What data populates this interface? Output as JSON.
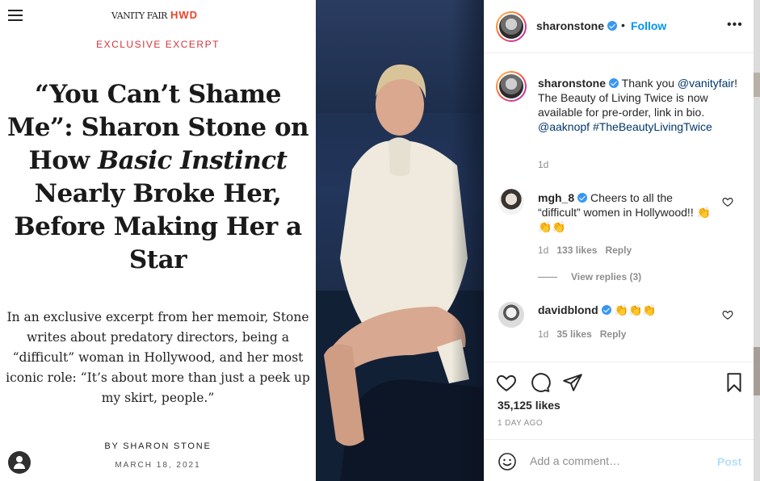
{
  "article": {
    "brand": "VANITY FAIR",
    "brand_sub": "HWD",
    "kicker": "EXCLUSIVE EXCERPT",
    "headline_part1": "“You Can’t Shame Me”: Sharon Stone on How ",
    "headline_italic": "Basic Instinct",
    "headline_part2": " Nearly Broke Her, Before Making Her a Star",
    "dek": "In an exclusive excerpt from her memoir, Stone writes about predatory directors, being a “difficult” woman in Hollywood, and her most iconic role: “It’s about more than just a peek up my skirt, people.”",
    "byline": "BY SHARON STONE",
    "date": "MARCH 18, 2021"
  },
  "post": {
    "username": "sharonstone",
    "separator": "•",
    "follow_label": "Follow",
    "more_label": "•••",
    "caption_text": " Thank you ",
    "caption_mention": "@vanityfair",
    "caption_text2": "! The Beauty of Living Twice is now available for pre-order, link in bio. ",
    "caption_mention2": "@aaknopf",
    "caption_hashtag": "#TheBeautyLivingTwice",
    "caption_age": "1d",
    "likes": "35,125 likes",
    "posted_ago": "1 DAY AGO"
  },
  "comments": [
    {
      "username": "mgh_8",
      "text": " Cheers to all the “difficult” women in Hollywood!! 👏👏👏",
      "age": "1d",
      "likes": "133 likes",
      "reply_label": "Reply",
      "view_replies": "View replies (3)"
    },
    {
      "username": "davidblond",
      "text": " 👏👏👏",
      "age": "1d",
      "likes": "35 likes",
      "reply_label": "Reply"
    }
  ],
  "composer": {
    "placeholder": "Add a comment…",
    "post_label": "Post"
  },
  "icons": {
    "menu": "hamburger-menu-icon",
    "account": "account-icon",
    "like": "heart-icon",
    "comment": "comment-icon",
    "share": "paper-plane-icon",
    "save": "bookmark-icon",
    "emoji": "smiley-icon"
  },
  "colors": {
    "accent_link": "#0095f6",
    "verified": "#3897f0",
    "kicker_red": "#d4333a",
    "muted": "#8e8e8e",
    "post_disabled": "#b2dffc"
  }
}
